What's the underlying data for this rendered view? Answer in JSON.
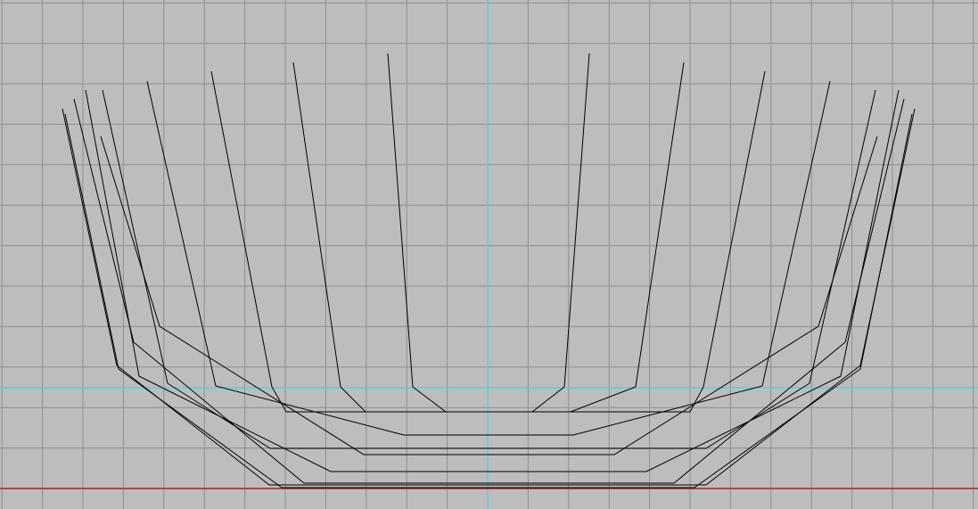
{
  "viewport": {
    "background_color": "#bdbdbd",
    "grid_color": "#8f8f8f",
    "x_axis_color": "#9a2a2a",
    "y_axis_color": "#40d8d8",
    "wire_color": "#000000",
    "construction_plane_color": "#40d8d8"
  }
}
